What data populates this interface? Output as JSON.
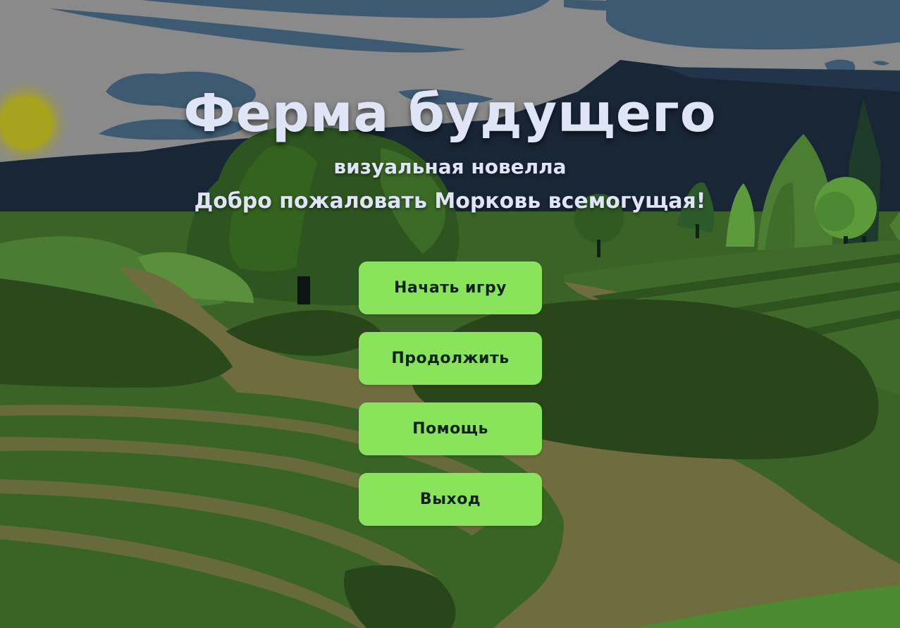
{
  "game": {
    "title": "Ферма будущего",
    "subtitle": "визуальная новелла",
    "welcome": "Добро пожаловать Морковь всемогущая!"
  },
  "menu": {
    "buttons": [
      {
        "label": "Начать игру"
      },
      {
        "label": "Продолжить"
      },
      {
        "label": "Помощь"
      },
      {
        "label": "Выход"
      }
    ]
  },
  "colors": {
    "button_bg": "#89e35b",
    "button_text": "#10231a",
    "title_text": "#dfe4f7",
    "sky": "#8a8a8a",
    "mountains": "#192635",
    "field_dark": "#284418",
    "field_light": "#3f6a2a",
    "path": "#6f6c40",
    "sun": "#a7a31e"
  }
}
